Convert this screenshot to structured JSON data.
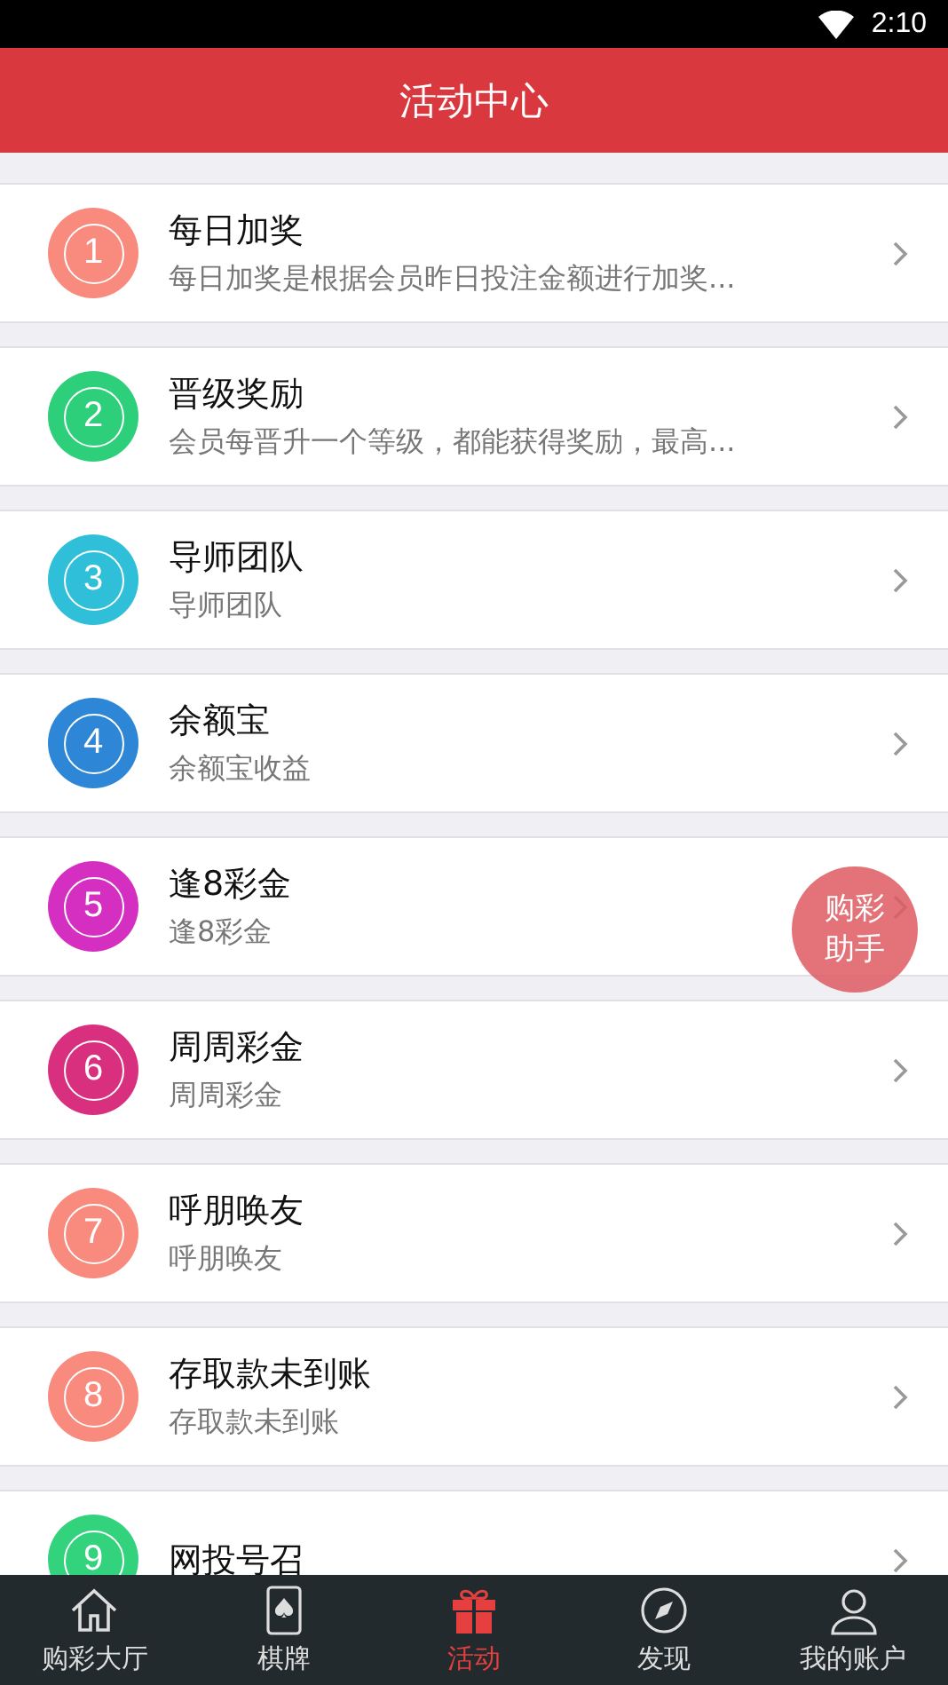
{
  "status_bar": {
    "time": "2:10"
  },
  "header": {
    "title": "活动中心"
  },
  "activities": [
    {
      "number": "1",
      "color": "#f98a7e",
      "title": "每日加奖",
      "subtitle": "每日加奖是根据会员昨日投注金额进行加奖..."
    },
    {
      "number": "2",
      "color": "#2ecf7a",
      "title": "晋级奖励",
      "subtitle": "会员每晋升一个等级，都能获得奖励，最高..."
    },
    {
      "number": "3",
      "color": "#2fbfd8",
      "title": "导师团队",
      "subtitle": "导师团队"
    },
    {
      "number": "4",
      "color": "#2d86d6",
      "title": "余额宝",
      "subtitle": "余额宝收益"
    },
    {
      "number": "5",
      "color": "#d42fc0",
      "title": "逢8彩金",
      "subtitle": "逢8彩金"
    },
    {
      "number": "6",
      "color": "#d8307f",
      "title": "周周彩金",
      "subtitle": "周周彩金"
    },
    {
      "number": "7",
      "color": "#f98a7e",
      "title": "呼朋唤友",
      "subtitle": "呼朋唤友"
    },
    {
      "number": "8",
      "color": "#f98a7e",
      "title": "存取款未到账",
      "subtitle": "存取款未到账"
    },
    {
      "number": "9",
      "color": "#33d27d",
      "title": "网投号召"
    }
  ],
  "floating_button": {
    "lines": [
      "购彩",
      "助手"
    ]
  },
  "tab_bar": [
    {
      "kind": "home",
      "label": "购彩大厅",
      "selected": false
    },
    {
      "kind": "cards",
      "label": "棋牌",
      "selected": false
    },
    {
      "kind": "gift",
      "label": "活动",
      "selected": true
    },
    {
      "kind": "compass",
      "label": "发现",
      "selected": false
    },
    {
      "kind": "person",
      "label": "我的账户",
      "selected": false
    }
  ]
}
